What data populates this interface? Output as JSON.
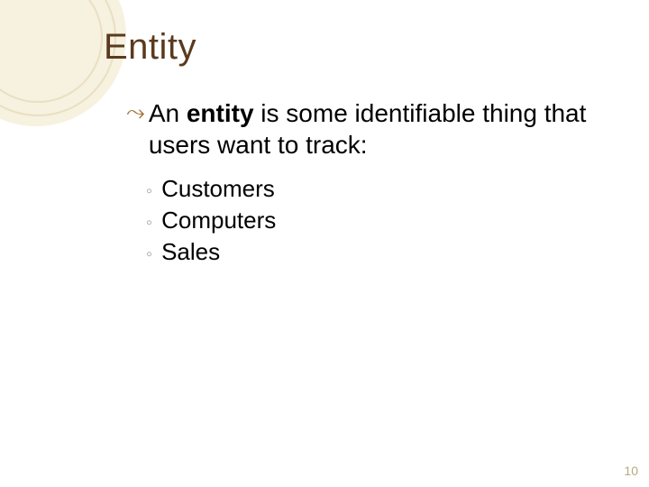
{
  "title": "Entity",
  "bullet": {
    "pre": "An ",
    "bold": "entity",
    "post": " is some identifiable thing that users want to track:"
  },
  "sub": {
    "a": "Customers",
    "b": "Computers",
    "c": "Sales"
  },
  "page_number": "10"
}
